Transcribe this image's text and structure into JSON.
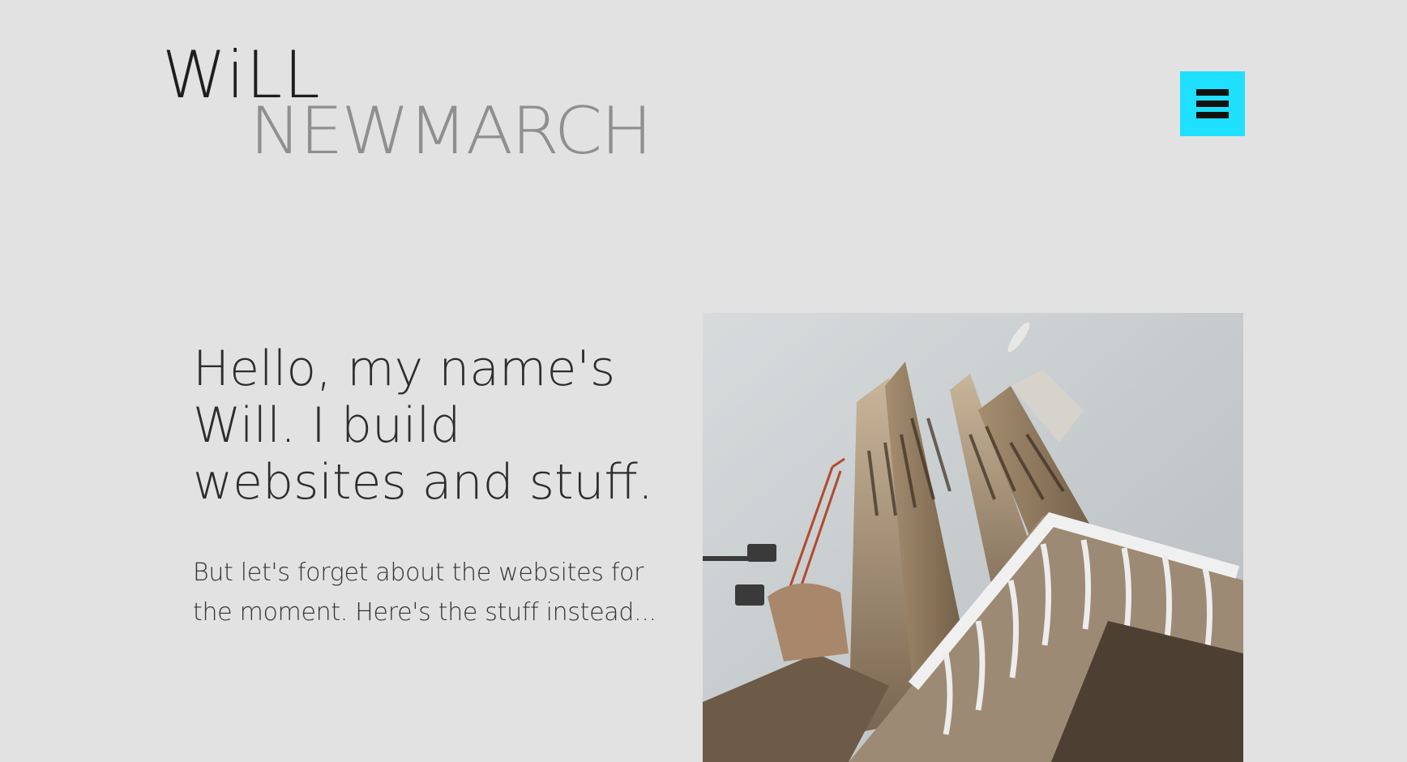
{
  "header": {
    "logo": {
      "line1": "WiLL",
      "line2": "NEWMARCH"
    },
    "menu_icon": "hamburger-icon",
    "menu_button_color": "#1fe0ff"
  },
  "hero": {
    "heading": "Hello, my name's Will. I build websites and stuff.",
    "intro": "But let's forget about the websites for the moment. Here's the stuff instead...",
    "photo_subject": "cathedral-towers-photo"
  },
  "colors": {
    "background": "#e2e2e2",
    "text": "#2d2d2d",
    "accent": "#1fe0ff",
    "logo_secondary": "#8a8a8a"
  }
}
